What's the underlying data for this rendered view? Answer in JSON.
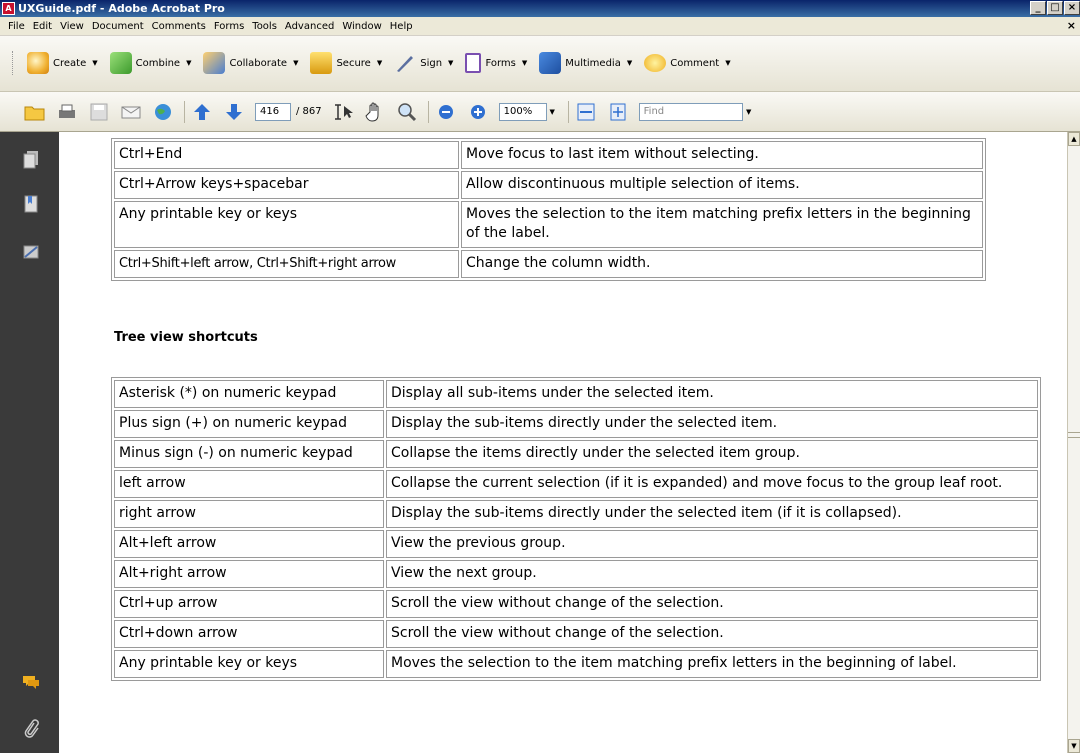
{
  "window": {
    "title": "UXGuide.pdf - Adobe Acrobat Pro",
    "app_icon_letter": "A",
    "controls": [
      "_",
      "□",
      "×"
    ]
  },
  "menu": {
    "items": [
      "File",
      "Edit",
      "View",
      "Document",
      "Comments",
      "Forms",
      "Tools",
      "Advanced",
      "Window",
      "Help"
    ],
    "close": "×"
  },
  "tasks_toolbar": {
    "items": [
      {
        "label": "Create",
        "icon": "create-icon"
      },
      {
        "label": "Combine",
        "icon": "combine-icon"
      },
      {
        "label": "Collaborate",
        "icon": "collaborate-icon"
      },
      {
        "label": "Secure",
        "icon": "lock-icon"
      },
      {
        "label": "Sign",
        "icon": "pen-icon"
      },
      {
        "label": "Forms",
        "icon": "forms-icon"
      },
      {
        "label": "Multimedia",
        "icon": "multimedia-icon"
      },
      {
        "label": "Comment",
        "icon": "comment-icon"
      }
    ],
    "caret": "▼"
  },
  "nav_toolbar": {
    "current_page": "416",
    "total_pages": "/ 867",
    "zoom": "100%",
    "find_placeholder": "Find",
    "caret": "▼"
  },
  "document": {
    "table1_rows": [
      [
        "Ctrl+End",
        "Move focus to last item without selecting."
      ],
      [
        "Ctrl+Arrow keys+spacebar",
        "Allow discontinuous multiple selection of items."
      ],
      [
        "Any printable key or keys",
        "Moves the selection to the item matching prefix letters in the beginning of the label."
      ],
      [
        "Ctrl+Shift+left arrow, Ctrl+Shift+right arrow",
        "Change the column width."
      ]
    ],
    "heading": "Tree view shortcuts",
    "table2_rows": [
      [
        "Asterisk (*) on numeric keypad",
        "Display all sub-items under the selected item."
      ],
      [
        "Plus sign (+) on numeric keypad",
        "Display the sub-items directly under the selected item."
      ],
      [
        "Minus sign (-) on numeric keypad",
        "Collapse the items directly under the selected item group."
      ],
      [
        "left arrow",
        "Collapse the current selection (if it is expanded) and move focus to the group leaf root."
      ],
      [
        "right arrow",
        "Display the sub-items directly under the selected item (if it is collapsed)."
      ],
      [
        "Alt+left arrow",
        "View the previous group."
      ],
      [
        "Alt+right arrow",
        "View the next group."
      ],
      [
        "Ctrl+up arrow",
        "Scroll the view without change of the selection."
      ],
      [
        "Ctrl+down arrow",
        "Scroll the view without change of the selection."
      ],
      [
        "Any printable key or keys",
        "Moves the selection to the item matching prefix letters in the beginning of label."
      ]
    ]
  },
  "scrollbar": {
    "up": "▲",
    "down": "▼"
  },
  "colors": {
    "titlebar": "#0a246a",
    "nav_panel": "#3a3a3a",
    "accent_blue": "#2f6fd0"
  }
}
